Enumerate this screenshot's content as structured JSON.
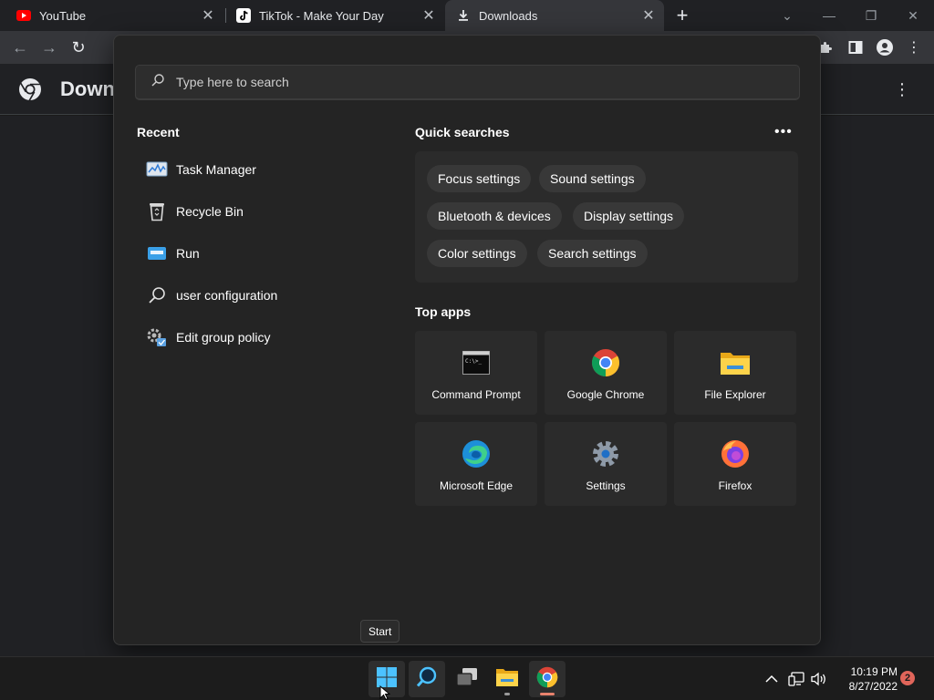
{
  "browser": {
    "tabs": [
      {
        "title": "YouTube",
        "favicon": "youtube-icon",
        "active": false
      },
      {
        "title": "TikTok - Make Your Day",
        "favicon": "tiktok-icon",
        "active": false
      },
      {
        "title": "Downloads",
        "favicon": "download-icon",
        "active": true
      }
    ],
    "page_title": "Down"
  },
  "search": {
    "placeholder": "Type here to search",
    "recent_title": "Recent",
    "recent": [
      {
        "label": "Task Manager",
        "icon": "task-manager-icon"
      },
      {
        "label": "Recycle Bin",
        "icon": "recycle-bin-icon"
      },
      {
        "label": "Run",
        "icon": "run-icon"
      },
      {
        "label": "user configuration",
        "icon": "search-icon"
      },
      {
        "label": "Edit group policy",
        "icon": "group-policy-icon"
      }
    ],
    "quick_title": "Quick searches",
    "quick": [
      "Focus settings",
      "Sound settings",
      "Bluetooth & devices",
      "Display settings",
      "Color settings",
      "Search settings"
    ],
    "top_title": "Top apps",
    "apps": [
      {
        "label": "Command Prompt",
        "icon": "command-prompt-icon"
      },
      {
        "label": "Google Chrome",
        "icon": "chrome-icon"
      },
      {
        "label": "File Explorer",
        "icon": "file-explorer-icon"
      },
      {
        "label": "Microsoft Edge",
        "icon": "edge-icon"
      },
      {
        "label": "Settings",
        "icon": "settings-gear-icon"
      },
      {
        "label": "Firefox",
        "icon": "firefox-icon"
      }
    ]
  },
  "tooltip": "Start",
  "taskbar": {
    "time": "10:19 PM",
    "date": "8/27/2022",
    "notifications": "2"
  },
  "colors": {
    "accent": "#60cdff",
    "youtube_red": "#ff0000",
    "chrome_active_indicator": "#e8826d"
  }
}
